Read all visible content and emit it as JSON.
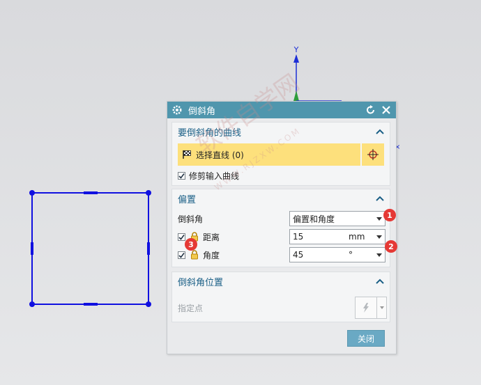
{
  "axis": {
    "y_label": "Y"
  },
  "dialog": {
    "title": "倒斜角",
    "curves_section": {
      "header": "要倒斜角的曲线",
      "select_label": "选择直线 (0)",
      "trim_checkbox": {
        "label": "修剪输入曲线",
        "checked": true
      }
    },
    "offset_section": {
      "header": "偏置",
      "chamfer_label": "倒斜角",
      "chamfer_value": "偏置和角度",
      "distance": {
        "label": "距离",
        "value": "15",
        "unit": "mm",
        "checked": true
      },
      "angle": {
        "label": "角度",
        "value": "45",
        "unit": "°",
        "checked": true
      }
    },
    "position_section": {
      "header": "倒斜角位置",
      "point_label": "指定点"
    },
    "close_label": "关闭"
  },
  "badges": {
    "b1": "1",
    "b2": "2",
    "b3": "3"
  },
  "watermark": {
    "main": "软件自学网",
    "sub": "WWW.RJZXW.COM"
  },
  "colors": {
    "title_bar": "#4f96ad",
    "selection": "#fde07c",
    "geometry": "#1010e0",
    "badge": "#e53935"
  }
}
